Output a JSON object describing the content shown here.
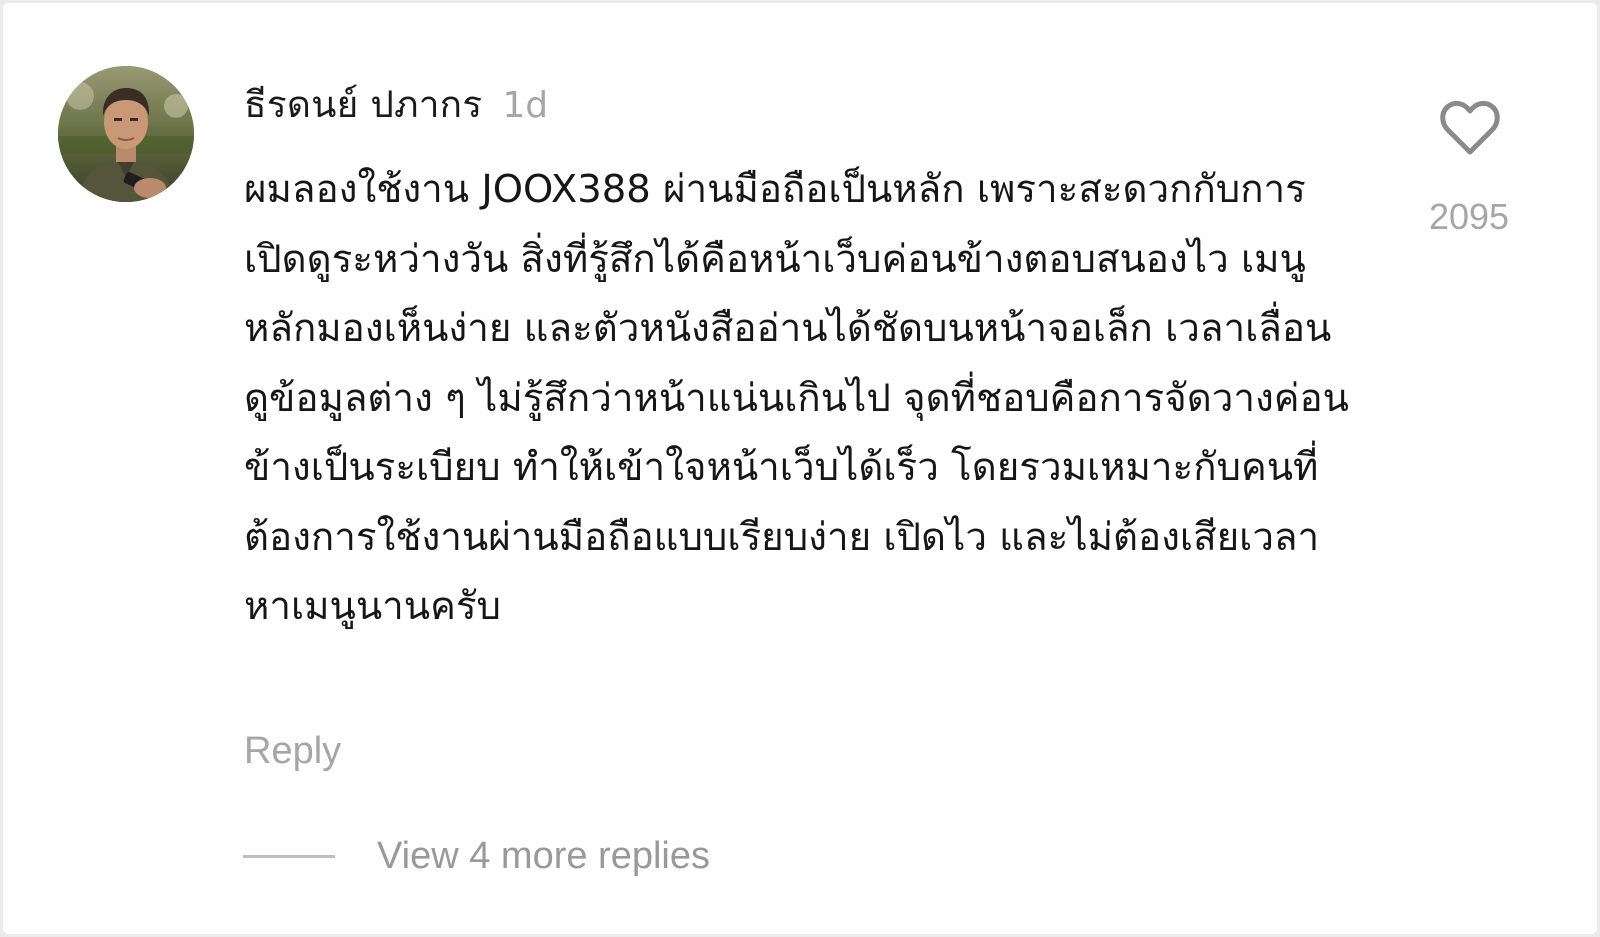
{
  "comment": {
    "author": "ธีรดนย์ ปภากร",
    "timestamp": "1d",
    "text": "ผมลองใช้งาน JOOX388 ผ่านมือถือเป็นหลัก เพราะสะดวกกับการเปิดดูระหว่างวัน สิ่งที่รู้สึกได้คือหน้าเว็บค่อนข้างตอบสนองไว เมนูหลักมองเห็นง่าย และตัวหนังสืออ่านได้ชัดบนหน้าจอเล็ก เวลาเลื่อนดูข้อมูลต่าง ๆ ไม่รู้สึกว่าหน้าแน่นเกินไป จุดที่ชอบคือการจัดวางค่อนข้างเป็นระเบียบ ทำให้เข้าใจหน้าเว็บได้เร็ว โดยรวมเหมาะกับคนที่ต้องการใช้งานผ่านมือถือแบบเรียบง่าย เปิดไว และไม่ต้องเสียเวลาหาเมนูนานครับ",
    "like_count": "2095",
    "reply_label": "Reply",
    "view_replies_label": "View 4 more replies"
  },
  "icons": {
    "like": "heart-outline-icon",
    "avatar": "user-avatar-photo"
  },
  "colors": {
    "text_primary": "#161616",
    "text_muted": "#a6a6a6",
    "icon_stroke": "#8a8a8a",
    "divider": "#bdbdbd",
    "background": "#ffffff"
  }
}
